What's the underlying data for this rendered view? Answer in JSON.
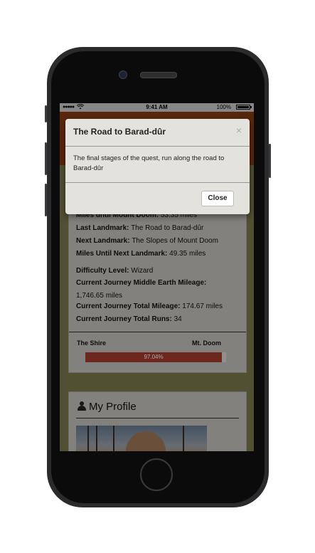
{
  "status_bar": {
    "signal": "●●●●●",
    "time": "9:41 AM",
    "battery": "100%"
  },
  "journey": {
    "miles_until_mount_doom_label": "Miles until Mount Doom:",
    "miles_until_mount_doom_value": "53.35 miles",
    "last_landmark_label": "Last Landmark:",
    "last_landmark_value": "The Road to Barad-dûr",
    "next_landmark_label": "Next Landmark:",
    "next_landmark_value": "The Slopes of Mount Doom",
    "miles_next_landmark_label": "Miles Until Next Landmark:",
    "miles_next_landmark_value": "49.35 miles",
    "difficulty_label": "Difficulty Level:",
    "difficulty_value": "Wizard",
    "middle_earth_mileage_label": "Current Journey Middle Earth Mileage:",
    "middle_earth_mileage_value": "1,746.65 miles",
    "total_mileage_label": "Current Journey Total Mileage:",
    "total_mileage_value": "174.67 miles",
    "total_runs_label": "Current Journey Total Runs:",
    "total_runs_value": "34"
  },
  "progress": {
    "start_label": "The Shire",
    "end_label": "Mt. Doom",
    "percent": 97.04,
    "percent_text": "97.04%",
    "fill_color": "#a83d2d"
  },
  "profile": {
    "icon": "user-icon",
    "title": "My Profile"
  },
  "modal": {
    "title": "The Road to Barad-dûr",
    "close_symbol": "×",
    "body": "The final stages of the quest, run along the road to Barad-dûr",
    "close_button": "Close"
  },
  "colors": {
    "nav": "#8b3c14",
    "background": "#7d7b4f",
    "card": "#c9c7c1"
  }
}
